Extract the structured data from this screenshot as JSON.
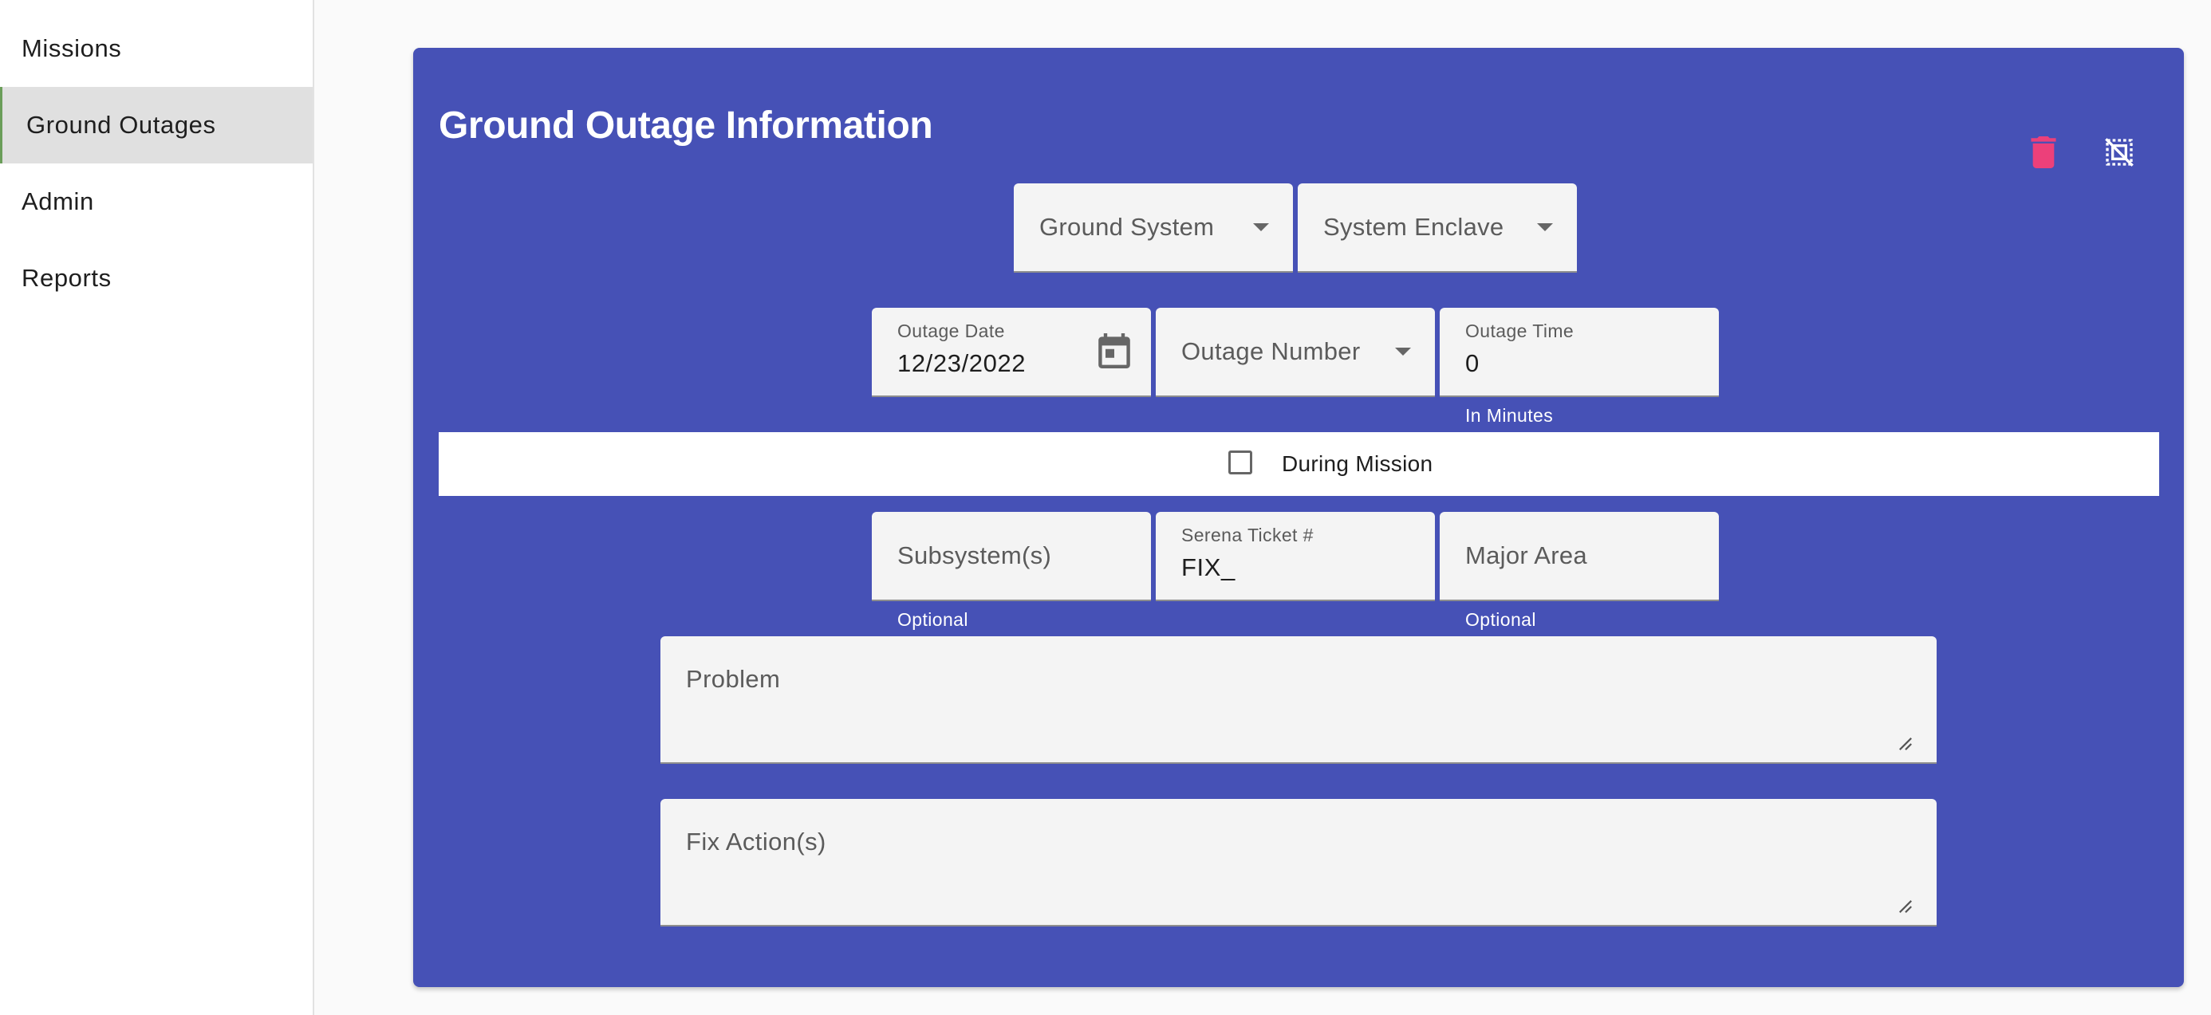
{
  "sidebar": {
    "items": [
      {
        "label": "Missions"
      },
      {
        "label": "Ground Outages"
      },
      {
        "label": "Admin"
      },
      {
        "label": "Reports"
      }
    ]
  },
  "card": {
    "title": "Ground Outage Information",
    "icons": {
      "delete": "delete-icon",
      "deselect": "deselect-icon"
    },
    "delete_color": "#ec407a",
    "background_color": "#4651b6"
  },
  "form": {
    "ground_system": {
      "placeholder": "Ground System"
    },
    "system_enclave": {
      "placeholder": "System Enclave"
    },
    "outage_date": {
      "label": "Outage Date",
      "value": "12/23/2022",
      "icon": "calendar-icon"
    },
    "outage_number": {
      "placeholder": "Outage Number"
    },
    "outage_time": {
      "label": "Outage Time",
      "value": "0",
      "hint": "In Minutes"
    },
    "during_mission": {
      "label": "During Mission",
      "checked": false
    },
    "subsystems": {
      "placeholder": "Subsystem(s)",
      "hint": "Optional"
    },
    "serena_ticket": {
      "label": "Serena Ticket #",
      "value": "FIX_"
    },
    "major_area": {
      "placeholder": "Major Area",
      "hint": "Optional"
    },
    "problem": {
      "placeholder": "Problem"
    },
    "fix_actions": {
      "placeholder": "Fix Action(s)"
    }
  }
}
